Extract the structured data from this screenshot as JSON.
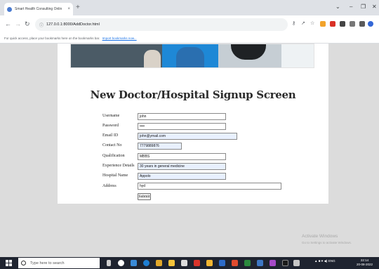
{
  "browser": {
    "tab_title": "Smart Health Consulting Onlin",
    "tab_close": "×",
    "new_tab": "+",
    "url": "127.0.0.1:8000/AddDoctor.html",
    "bookmarks_prompt": "For quick access, place your bookmarks here on the bookmarks bar.",
    "bookmarks_link": "Import bookmarks now..."
  },
  "page": {
    "heading": "New Doctor/Hospital Signup Screen",
    "form": [
      {
        "label": "Username",
        "value": "john",
        "filled": false
      },
      {
        "label": "Password",
        "value": "••••",
        "filled": false
      },
      {
        "label": "Email ID",
        "value": "john@ymail.com",
        "filled": true
      },
      {
        "label": "Contact No",
        "value": "7779889876",
        "filled": true
      },
      {
        "label": "Qualification",
        "value": "MBBS",
        "filled": false
      },
      {
        "label": "Experience Details",
        "value": "30 years in general medicine",
        "filled": true
      },
      {
        "label": "Hospital Name",
        "value": "Appolo",
        "filled": true
      },
      {
        "label": "Address",
        "value": "hyd",
        "filled": false
      }
    ],
    "submit_label": "Submit"
  },
  "watermark": {
    "title": "Activate Windows",
    "subtitle": "Go to Settings to activate Windows."
  },
  "taskbar": {
    "search_placeholder": "Type here to search",
    "time": "22:14",
    "date": "20-08-2022",
    "tray_text": "ENG"
  },
  "colors": {
    "autofill": "#e8f0fe",
    "taskbar": "#1f2430",
    "page_background": "#dcdcdc"
  }
}
